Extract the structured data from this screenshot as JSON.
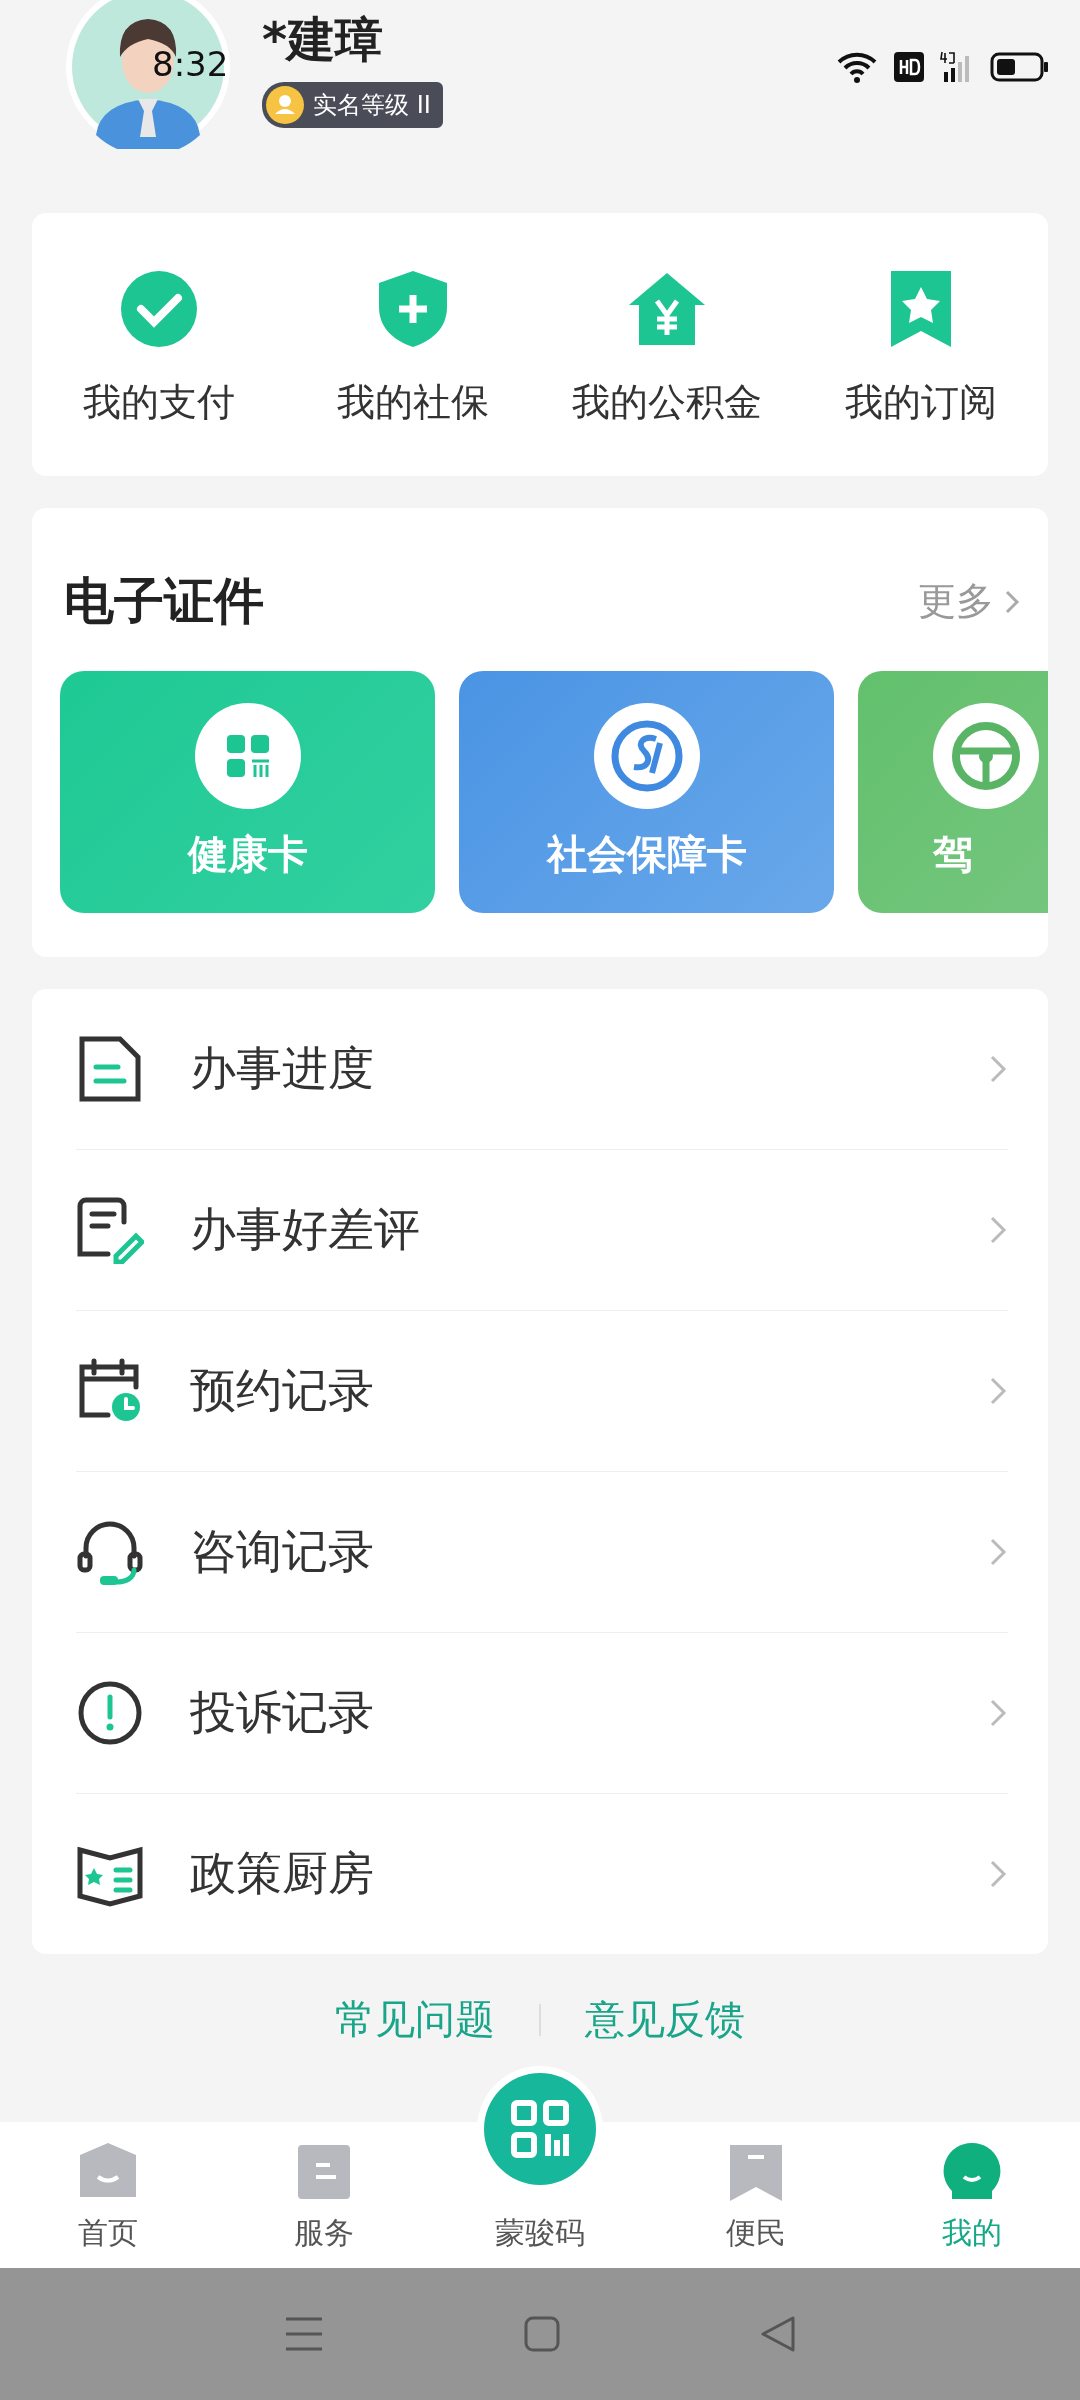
{
  "status_bar": {
    "time": "8:32"
  },
  "profile": {
    "name": "*建璋",
    "badge": "实名等级 II"
  },
  "quick_actions": [
    {
      "label": "我的支付",
      "kind": "pay"
    },
    {
      "label": "我的社保",
      "kind": "insurance"
    },
    {
      "label": "我的公积金",
      "kind": "fund"
    },
    {
      "label": "我的订阅",
      "kind": "subscribe"
    }
  ],
  "certificates": {
    "title": "电子证件",
    "more": "更多",
    "cards": [
      {
        "label": "健康卡",
        "kind": "health"
      },
      {
        "label": "社会保障卡",
        "kind": "social"
      },
      {
        "label": "驾",
        "kind": "driving"
      }
    ]
  },
  "menu": [
    {
      "label": "办事进度",
      "kind": "progress"
    },
    {
      "label": "办事好差评",
      "kind": "review"
    },
    {
      "label": "预约记录",
      "kind": "booking"
    },
    {
      "label": "咨询记录",
      "kind": "consult"
    },
    {
      "label": "投诉记录",
      "kind": "complaint"
    },
    {
      "label": "政策厨房",
      "kind": "policy"
    }
  ],
  "footer_links": [
    "常见问题",
    "意见反馈"
  ],
  "tab_bar": [
    {
      "label": "首页",
      "kind": "home",
      "selected": false
    },
    {
      "label": "服务",
      "kind": "service",
      "selected": false
    },
    {
      "label": "蒙骏码",
      "kind": "code",
      "selected": false
    },
    {
      "label": "便民",
      "kind": "convenience",
      "selected": false
    },
    {
      "label": "我的",
      "kind": "mine",
      "selected": true
    }
  ]
}
